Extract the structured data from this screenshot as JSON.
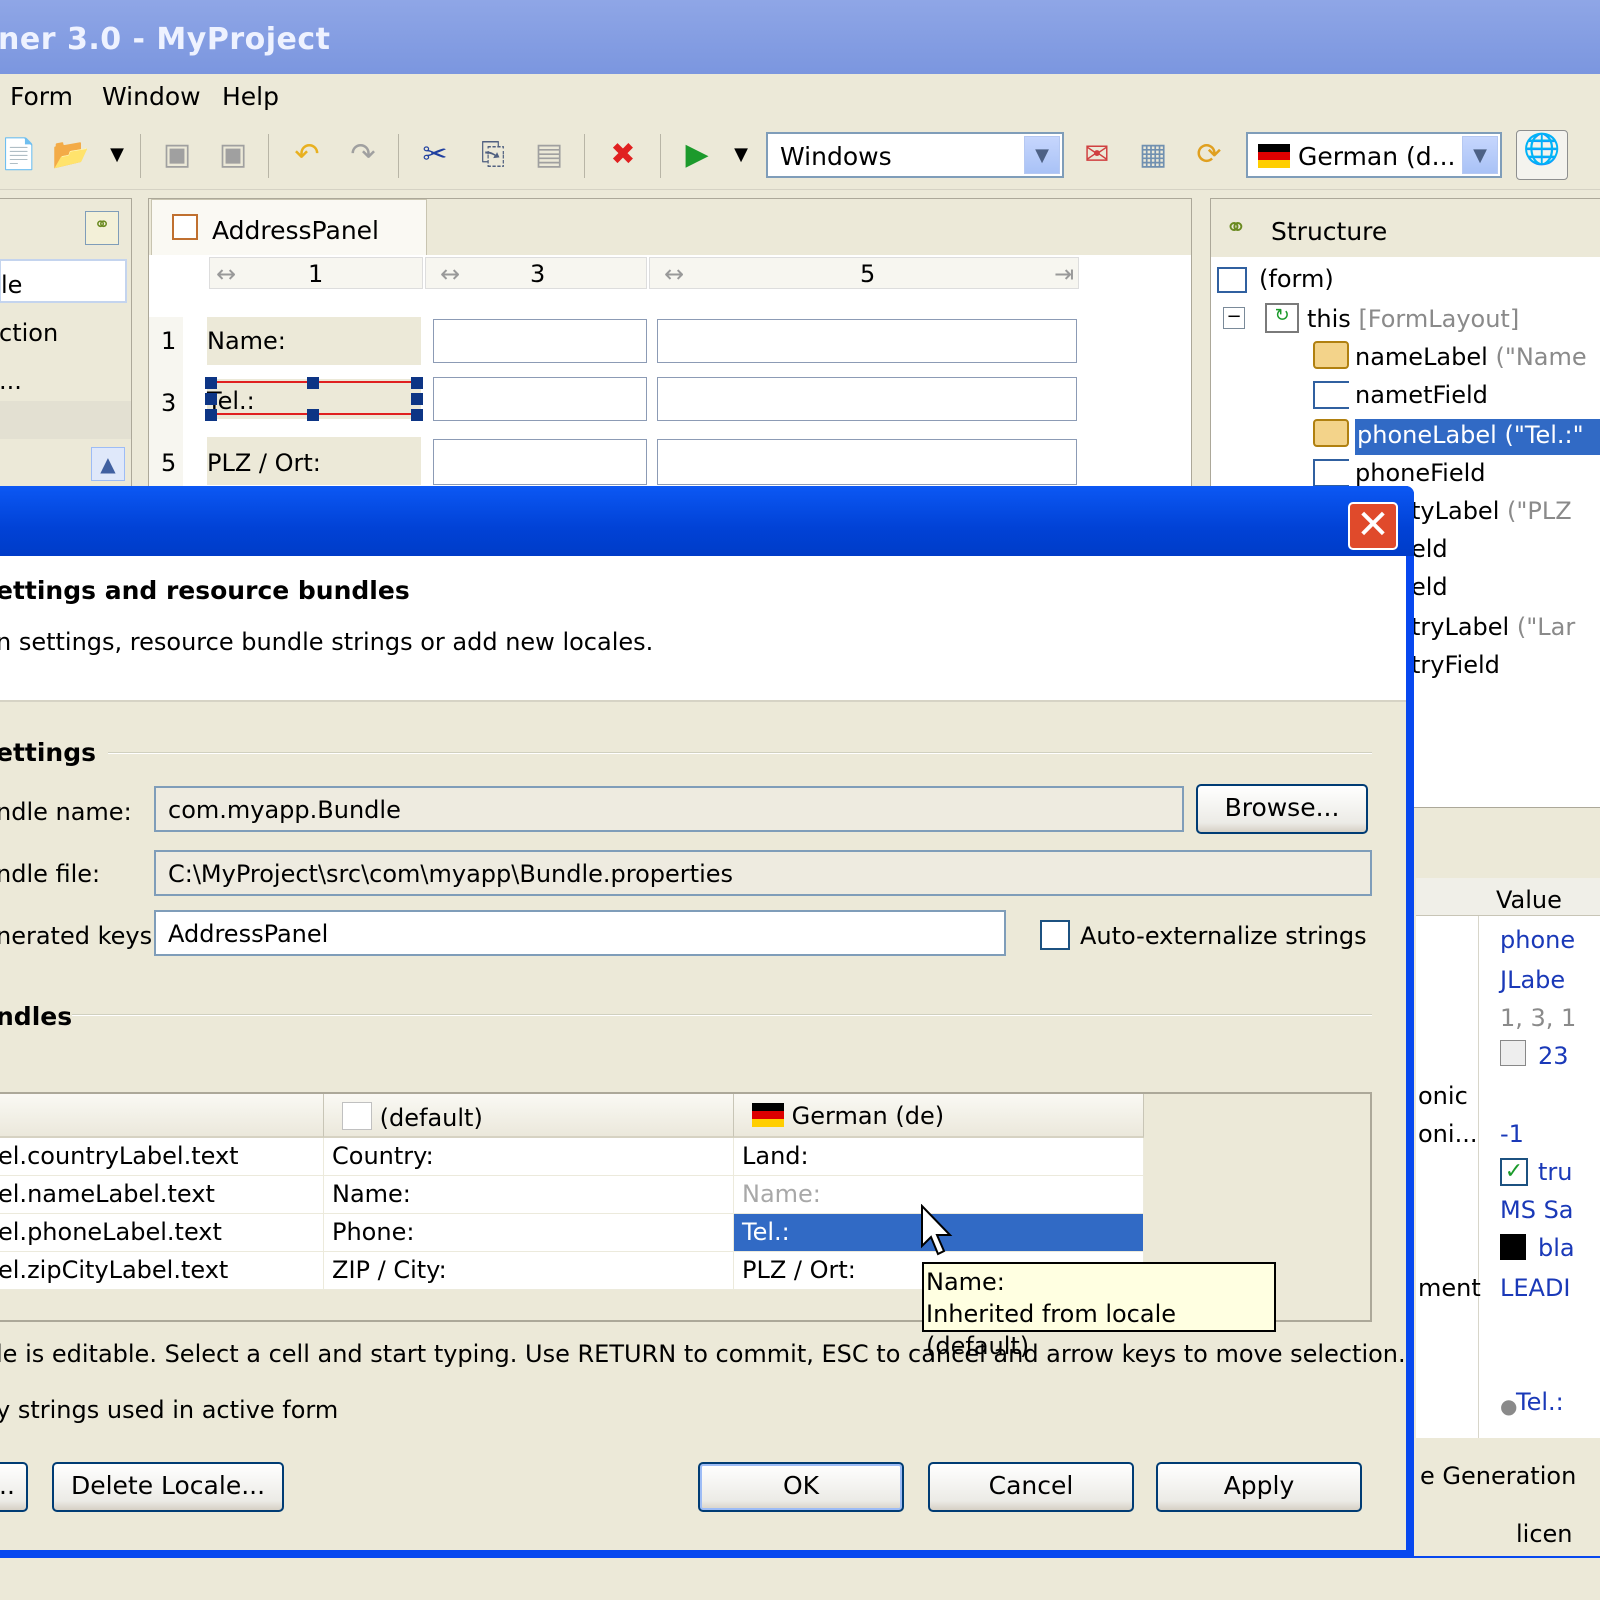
{
  "window": {
    "title": "ner 3.0 - MyProject"
  },
  "menu": [
    "Form",
    "Window",
    "Help"
  ],
  "toolbar": {
    "lookandfeel": "Windows",
    "locale": "German (d..."
  },
  "left_panel": {
    "items": [
      "le",
      "ction",
      "..."
    ]
  },
  "editor": {
    "tab": "AddressPanel",
    "col_headers": [
      "1",
      "3",
      "5"
    ],
    "row_headers": [
      "1",
      "3",
      "5"
    ],
    "labels": [
      "Name:",
      "Tel.:",
      "PLZ / Ort:"
    ]
  },
  "structure": {
    "title": "Structure",
    "nodes": [
      {
        "name": "(form)",
        "extra": ""
      },
      {
        "name": "this",
        "extra": "[FormLayout]"
      },
      {
        "name": "nameLabel",
        "extra": "(\"Name"
      },
      {
        "name": "nametField",
        "extra": ""
      },
      {
        "name": "phoneLabel (\"Tel.:\"",
        "extra": ""
      },
      {
        "name": "phoneField",
        "extra": ""
      },
      {
        "name": "tyLabel",
        "extra": "(\"PLZ"
      },
      {
        "name": "eld",
        "extra": ""
      },
      {
        "name": "eld",
        "extra": ""
      },
      {
        "name": "tryLabel",
        "extra": "(\"Lar"
      },
      {
        "name": "tryField",
        "extra": ""
      }
    ]
  },
  "properties": {
    "value_header": "Value",
    "rows": [
      {
        "name": "",
        "value": "phone"
      },
      {
        "name": "",
        "value": "JLabe"
      },
      {
        "name": "",
        "value": "1, 3, 1"
      },
      {
        "name": "",
        "value": "23"
      },
      {
        "name": "onic",
        "value": ""
      },
      {
        "name": "oni...",
        "value": "-1"
      },
      {
        "name": "",
        "value": "tru"
      },
      {
        "name": "",
        "value": "MS Sa"
      },
      {
        "name": "",
        "value": "bla"
      },
      {
        "name": "ment",
        "value": "LEADI"
      },
      {
        "name": "",
        "value": ""
      },
      {
        "name": "",
        "value": ""
      },
      {
        "name": "",
        "value": "Tel.:"
      }
    ],
    "footer": "e Generation",
    "status": "licen"
  },
  "dialog": {
    "header_title": "ettings and resource bundles",
    "header_desc": "n settings, resource bundle strings or add new locales.",
    "section_settings": "ettings",
    "bundle_name_label": "ndle name:",
    "bundle_name_value": "com.myapp.Bundle",
    "browse_button": "Browse...",
    "bundle_file_label": "ndle file:",
    "bundle_file_value": "C:\\MyProject\\src\\com\\myapp\\Bundle.properties",
    "keys_label": "nerated keys:",
    "keys_value": "AddressPanel",
    "auto_externalize": "Auto-externalize strings",
    "section_bundles": "ndles",
    "table": {
      "headers": [
        "",
        "(default)",
        "German (de)"
      ],
      "rows": [
        [
          "el.countryLabel.text",
          "Country:",
          "Land:"
        ],
        [
          "el.nameLabel.text",
          "Name:",
          "Name:"
        ],
        [
          "el.phoneLabel.text",
          "Phone:",
          "Tel.:"
        ],
        [
          "el.zipCityLabel.text",
          "ZIP / City:",
          "PLZ / Ort:"
        ]
      ]
    },
    "tooltip_line1": "Name:",
    "tooltip_line2": "Inherited from locale (default)",
    "hint": "le is editable. Select a cell and start typing. Use RETURN to commit, ESC to cancel and arrow keys to move selection.",
    "only_strings": "y strings used in active form",
    "btn_partial": "..",
    "btn_delete_locale": "Delete Locale...",
    "btn_ok": "OK",
    "btn_cancel": "Cancel",
    "btn_apply": "Apply"
  }
}
